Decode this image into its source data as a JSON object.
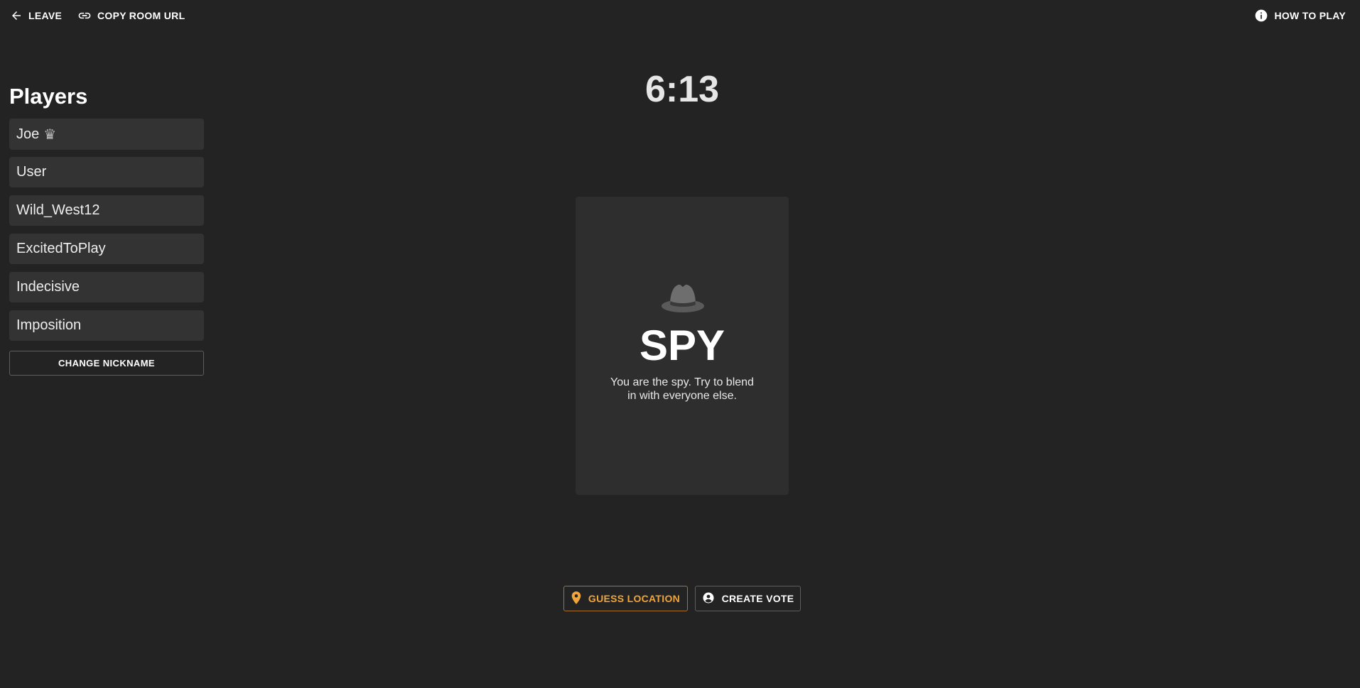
{
  "topbar": {
    "leave_label": "LEAVE",
    "copy_label": "COPY ROOM URL",
    "howto_label": "HOW TO PLAY"
  },
  "players": {
    "title": "Players",
    "items": [
      {
        "name": "Joe",
        "host_icon": "♛"
      },
      {
        "name": "User"
      },
      {
        "name": "Wild_West12"
      },
      {
        "name": "ExcitedToPlay"
      },
      {
        "name": "Indecisive"
      },
      {
        "name": "Imposition"
      }
    ],
    "change_nickname_label": "CHANGE NICKNAME"
  },
  "timer": "6:13",
  "card": {
    "icon": "fedora-hat-icon",
    "role": "SPY",
    "description": "You are the spy. Try to blend in with everyone else."
  },
  "actions": {
    "guess_label": "GUESS LOCATION",
    "vote_label": "CREATE VOTE"
  },
  "colors": {
    "background": "#232323",
    "card": "#2e2e2e",
    "player_item": "#333333",
    "accent": "#f0a53a"
  }
}
